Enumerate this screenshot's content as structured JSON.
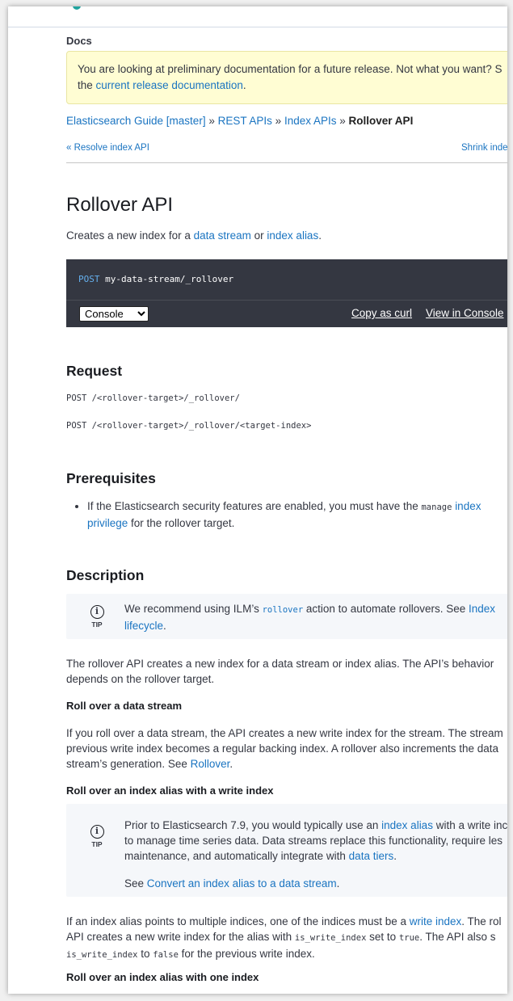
{
  "docs_label": "Docs",
  "notice": {
    "line1": "You are looking at preliminary documentation for a future release. Not what you want? S",
    "line2_prefix": "the ",
    "link": "current release documentation",
    "line2_suffix": "."
  },
  "breadcrumb": {
    "items": [
      "Elasticsearch Guide [master]",
      "REST APIs",
      "Index APIs"
    ],
    "separator": "»",
    "current": "Rollover API"
  },
  "nav": {
    "prev": "« Resolve index API",
    "next": "Shrink inde"
  },
  "title": "Rollover API",
  "lead": {
    "prefix": "Creates a new index for a ",
    "link1": "data stream",
    "mid": " or ",
    "link2": "index alias",
    "suffix": "."
  },
  "console": {
    "method": "POST",
    "path": "my-data-stream/_rollover",
    "select_value": "Console",
    "copy_curl": "Copy as curl",
    "view_console": "View in Console"
  },
  "request": {
    "heading": "Request",
    "lines": [
      "POST /<rollover-target>/_rollover/",
      "POST /<rollover-target>/_rollover/<target-index>"
    ]
  },
  "prereq": {
    "heading": "Prerequisites",
    "text1": "If the Elasticsearch security features are enabled, you must have the ",
    "code": "manage",
    "link1": "index",
    "link2": "privilege",
    "text2": " for the rollover target."
  },
  "description": {
    "heading": "Description",
    "tip1": {
      "label": "TIP",
      "prefix": "We recommend using ILM’s ",
      "code": "rollover",
      "mid": " action to automate rollovers. See ",
      "link_a": "Index",
      "link_b": "lifecycle",
      "suffix": "."
    },
    "para1_l1": "The rollover API creates a new index for a data stream or index alias. The API’s behavior",
    "para1_l2": "depends on the rollover target.",
    "h_stream": "Roll over a data stream",
    "stream_l1": "If you roll over a data stream, the API creates a new write index for the stream. The stream",
    "stream_l2": "previous write index becomes a regular backing index. A rollover also increments the data",
    "stream_l3_prefix": "stream’s generation. See ",
    "stream_link": "Rollover",
    "stream_l3_suffix": ".",
    "h_alias_write": "Roll over an index alias with a write index",
    "tip2": {
      "label": "TIP",
      "l1_prefix": "Prior to Elasticsearch 7.9, you would typically use an ",
      "l1_link": "index alias",
      "l1_suffix": " with a write inc",
      "l2": "to manage time series data. Data streams replace this functionality, require les",
      "l3_prefix": "maintenance, and automatically integrate with ",
      "l3_link": "data tiers",
      "l3_suffix": ".",
      "see_prefix": "See ",
      "see_link": "Convert an index alias to a data stream",
      "see_suffix": "."
    },
    "alias_l1_prefix": "If an index alias points to multiple indices, one of the indices must be a ",
    "alias_l1_link": "write index",
    "alias_l1_suffix": ". The rol",
    "alias_l2_prefix": "API creates a new write index for the alias with ",
    "alias_l2_code1": "is_write_index",
    "alias_l2_mid": " set to ",
    "alias_l2_code2": "true",
    "alias_l2_suffix": ". The API also s",
    "alias_l3_code1": "is_write_index",
    "alias_l3_mid1": " to ",
    "alias_l3_code2": "false",
    "alias_l3_suffix": " for the previous write index.",
    "h_alias_one": "Roll over an index alias with one index"
  }
}
